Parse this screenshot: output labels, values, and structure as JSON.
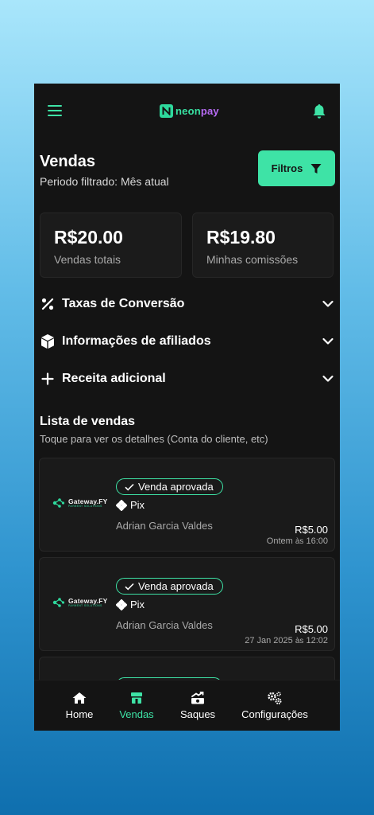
{
  "app": {
    "logo_part1": "neon",
    "logo_part2": "pay",
    "accent_color": "#3ee3a6"
  },
  "header": {
    "title": "Vendas",
    "subtitle": "Periodo filtrado: Mês atual",
    "filter_label": "Filtros"
  },
  "stats": [
    {
      "value": "R$20.00",
      "label": "Vendas totais"
    },
    {
      "value": "R$19.80",
      "label": "Minhas comissões"
    }
  ],
  "sections": [
    {
      "label": "Taxas de Conversão",
      "icon": "percent-icon"
    },
    {
      "label": "Informações de afiliados",
      "icon": "box-icon"
    },
    {
      "label": "Receita adicional",
      "icon": "plus-icon"
    }
  ],
  "sales_list": {
    "title": "Lista de vendas",
    "subtitle": "Toque para ver os detalhes (Conta do cliente, etc)",
    "items": [
      {
        "gateway_name": "Gateway.FY",
        "gateway_tag": "PAYMENT SOLUTIONS",
        "status": "Venda aprovada",
        "method": "Pix",
        "customer": "Adrian Garcia Valdes",
        "amount": "R$5.00",
        "date": "Ontem",
        "sep": "às",
        "time": "16:00"
      },
      {
        "gateway_name": "Gateway.FY",
        "gateway_tag": "PAYMENT SOLUTIONS",
        "status": "Venda aprovada",
        "method": "Pix",
        "customer": "Adrian Garcia Valdes",
        "amount": "R$5.00",
        "date": "27 Jan 2025",
        "sep": "às",
        "time": "12:02"
      }
    ]
  },
  "nav": [
    {
      "label": "Home",
      "icon": "home-icon"
    },
    {
      "label": "Vendas",
      "icon": "store-icon",
      "active": true
    },
    {
      "label": "Saques",
      "icon": "money-icon"
    },
    {
      "label": "Configurações",
      "icon": "gears-icon"
    }
  ]
}
